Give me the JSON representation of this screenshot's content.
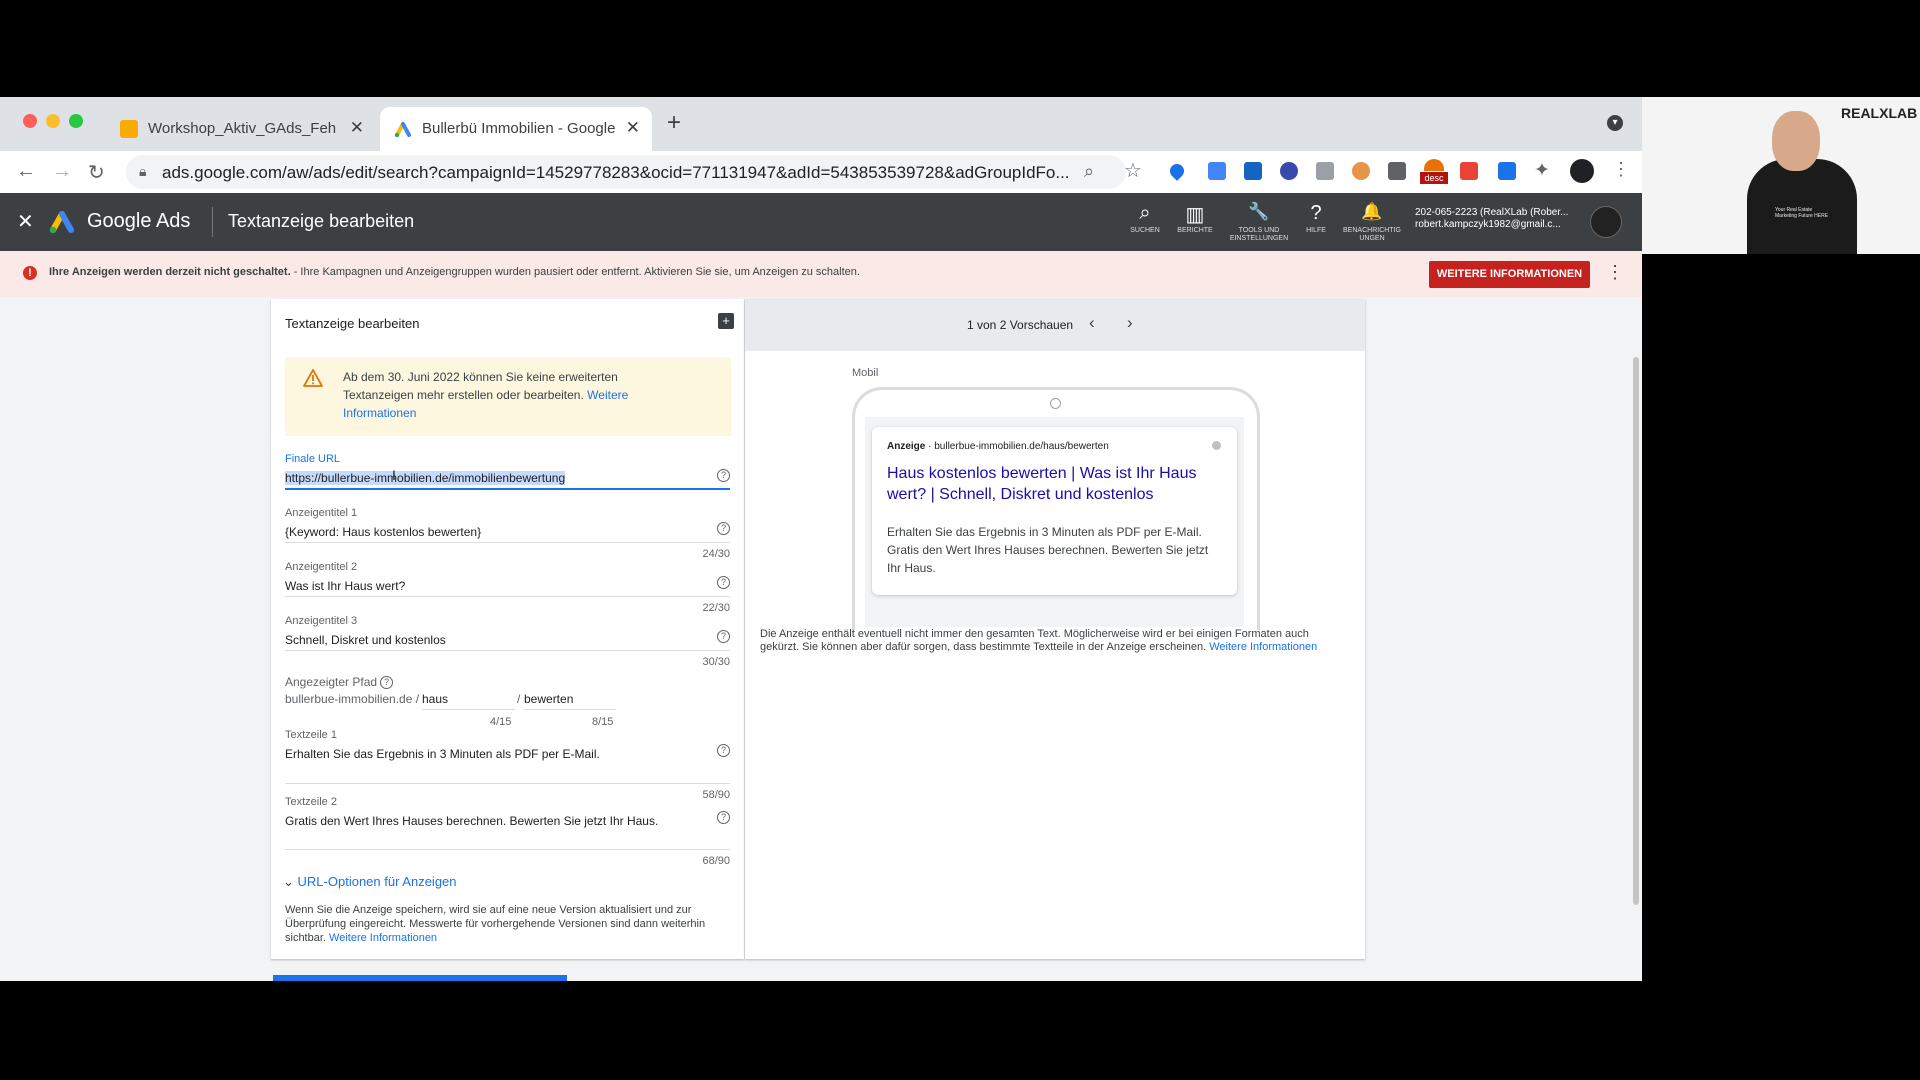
{
  "browser": {
    "tabs": [
      {
        "title": "Workshop_Aktiv_GAds_Fehler",
        "close": "✕",
        "active": false
      },
      {
        "title": "Bullerbü Immobilien - Google A",
        "close": "✕",
        "active": true
      }
    ],
    "new_tab": "+",
    "address": "ads.google.com/aw/ads/edit/search?campaignId=14529778283&ocid=771131947&adId=543853539728&adGroupIdFo...",
    "ext_badge": "desc"
  },
  "header": {
    "close": "✕",
    "brand": "Google Ads",
    "title": "Textanzeige bearbeiten",
    "actions": [
      {
        "icon": "⌕",
        "label": "SUCHEN"
      },
      {
        "icon": "▥",
        "label": "BERICHTE"
      },
      {
        "icon": "🔧",
        "label": "TOOLS UND EINSTELLUNGEN"
      },
      {
        "icon": "?",
        "label": "HILFE"
      },
      {
        "icon": "🔔",
        "label": "BENACHRICHTIG UNGEN"
      }
    ],
    "account_id": "202-065-2223 (RealXLab (Rober...",
    "account_email": "robert.kampczyk1982@gmail.c..."
  },
  "banner": {
    "bold": "Ihre Anzeigen werden derzeit nicht geschaltet.",
    "text": " - Ihre Kampagnen und Anzeigengruppen wurden pausiert oder entfernt. Aktivieren Sie sie, um Anzeigen zu schalten.",
    "button": "WEITERE INFORMATIONEN"
  },
  "form": {
    "title": "Textanzeige bearbeiten",
    "warning_text": "Ab dem 30. Juni 2022 können Sie keine erweiterten Textanzeigen mehr erstellen oder bearbeiten. ",
    "warning_link": "Weitere Informationen",
    "final_url_label": "Finale URL",
    "final_url": "https://bullerbue-immobilien.de/immobilienbewertung",
    "headline1_label": "Anzeigentitel 1",
    "headline1": "{Keyword: Haus kostenlos bewerten}",
    "headline1_count": "24/30",
    "headline2_label": "Anzeigentitel 2",
    "headline2": "Was ist Ihr Haus wert?",
    "headline2_count": "22/30",
    "headline3_label": "Anzeigentitel 3",
    "headline3": "Schnell, Diskret und kostenlos",
    "headline3_count": "30/30",
    "path_label": "Angezeigter Pfad",
    "path_domain": "bullerbue-immobilien.de /",
    "path1": "haus",
    "path_sep": "/",
    "path2": "bewerten",
    "path1_count": "4/15",
    "path2_count": "8/15",
    "desc1_label": "Textzeile 1",
    "desc1": "Erhalten Sie das Ergebnis in 3 Minuten als PDF per E-Mail.",
    "desc1_count": "58/90",
    "desc2_label": "Textzeile 2",
    "desc2": "Gratis den Wert Ihres Hauses berechnen. Bewerten Sie jetzt Ihr Haus.",
    "desc2_count": "68/90",
    "url_options": "URL-Optionen für Anzeigen",
    "footer_text": "Wenn Sie die Anzeige speichern, wird sie auf eine neue Version aktualisiert und zur Überprüfung eingereicht. Messwerte für vorhergehende Versionen sind dann weiterhin sichtbar. ",
    "footer_link": "Weitere Informationen"
  },
  "preview": {
    "pager": "1 von 2 Vorschauen",
    "device": "Mobil",
    "ad_label": "Anzeige",
    "ad_url": "· bullerbue-immobilien.de/haus/bewerten",
    "ad_headline": "Haus kostenlos bewerten | Was ist Ihr Haus wert? | Schnell, Diskret und kostenlos",
    "ad_desc": "Erhalten Sie das Ergebnis in 3 Minuten als PDF per E-Mail. Gratis den Wert Ihres Hauses berechnen. Bewerten Sie jetzt Ihr Haus.",
    "note": "Die Anzeige enthält eventuell nicht immer den gesamten Text. Möglicherweise wird er bei einigen Formaten auch gekürzt. Sie können aber dafür sorgen, dass bestimmte Textteile in der Anzeige erscheinen. ",
    "note_link": "Weitere Informationen"
  },
  "overlay": {
    "logo": "REALXLAB",
    "shirt": "Your Real Estate Marketing Future HERE"
  },
  "colors": {
    "accent": "#1a73e8",
    "danger": "#d93025",
    "header": "#3c4043",
    "warning_bg": "#fef7e0"
  }
}
